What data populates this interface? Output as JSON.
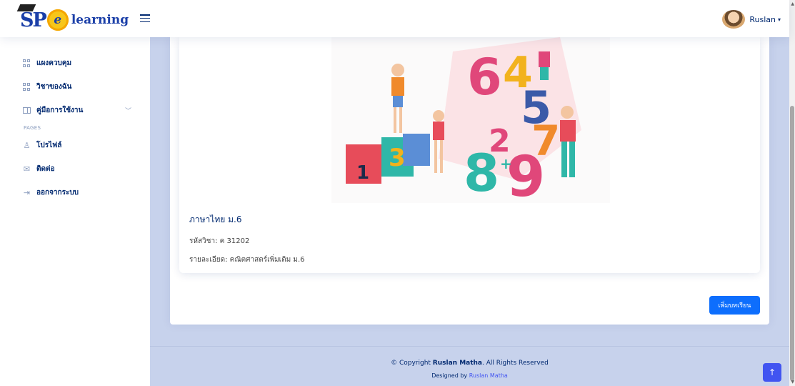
{
  "brand": {
    "logo_text": "learning",
    "logo_initials": "SP",
    "logo_mark": "e"
  },
  "header": {
    "user_name": "Ruslan"
  },
  "sidebar": {
    "items": [
      {
        "label": "แผงควบคุม",
        "icon": "grid-icon"
      },
      {
        "label": "วิชาของฉัน",
        "icon": "grid-icon"
      },
      {
        "label": "คู่มือการใช้งาน",
        "icon": "book-icon"
      }
    ],
    "pages_heading": "PAGES",
    "pages": [
      {
        "label": "โปรไฟล์",
        "icon": "person-icon"
      },
      {
        "label": "ติดต่อ",
        "icon": "envelope-icon"
      },
      {
        "label": "ออกจากระบบ",
        "icon": "logout-icon"
      }
    ]
  },
  "course": {
    "title": "ภาษาไทย ม.6",
    "code": "รหัสวิชา: ค 31202",
    "description": "รายละเอียด: คณิตศาสตร์เพิ่มเติม ม.6",
    "add_lesson_label": "เพิ่มบทเรียน"
  },
  "illustration": {
    "numbers": [
      "1",
      "6",
      "3",
      "4",
      "5",
      "7",
      "8",
      "9",
      "2",
      "+"
    ]
  },
  "footer": {
    "copyright_prefix": "© Copyright ",
    "copyright_owner": "Ruslan Matha",
    "copyright_suffix": ". All Rights Reserved",
    "designed_by": "Designed by ",
    "designer": "Ruslan Matha"
  },
  "colors": {
    "primary": "#0d6efd",
    "brand": "#012970",
    "accent": "#4154f1",
    "background": "#c7d2ec"
  }
}
